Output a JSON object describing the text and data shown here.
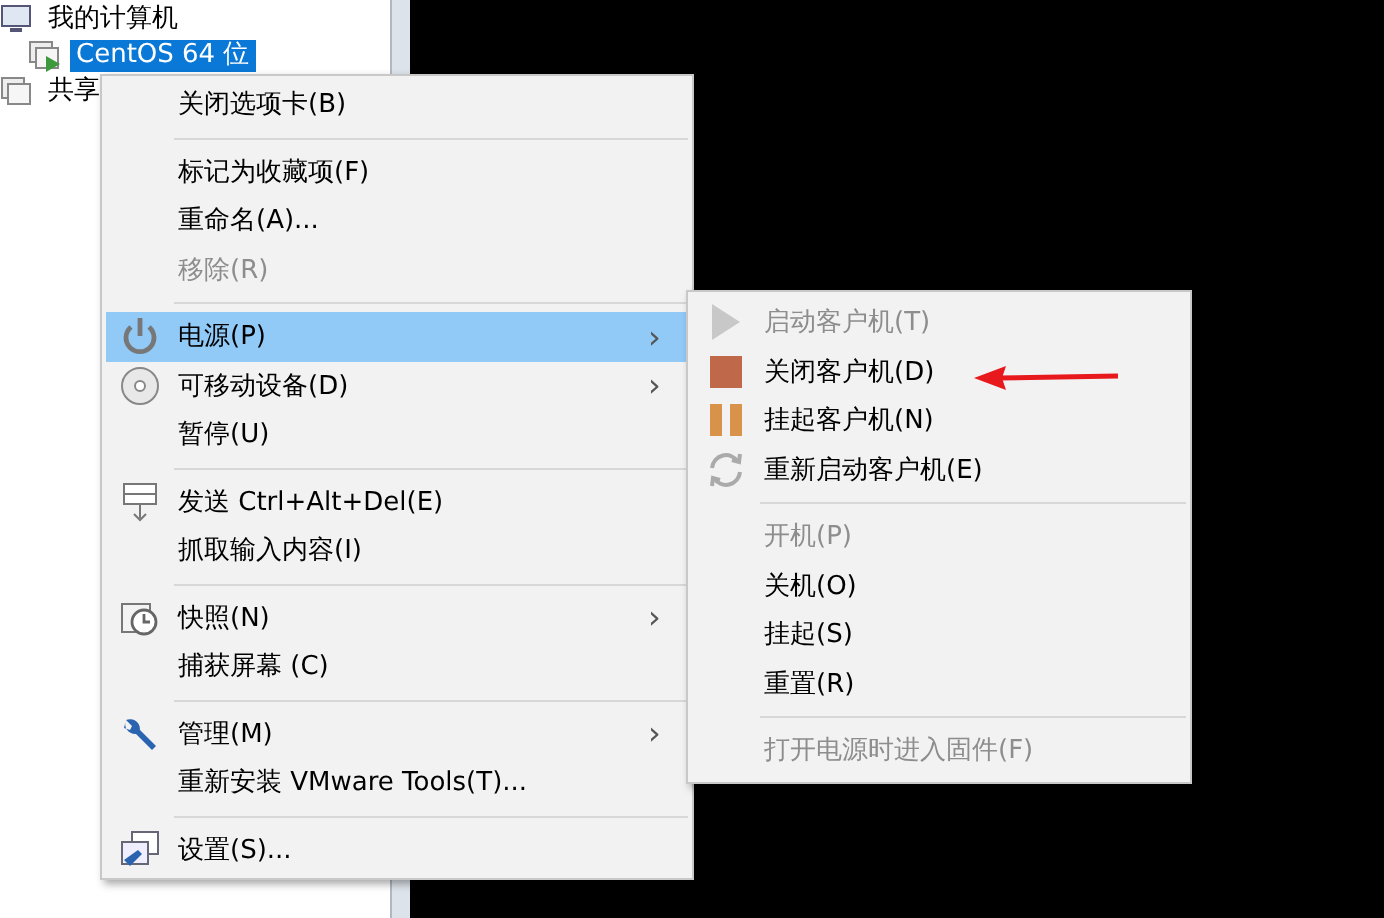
{
  "tree": [
    {
      "label": "我的计算机",
      "selected": false
    },
    {
      "label": "CentOS 64 位",
      "selected": true
    },
    {
      "label": "共享",
      "selected": false
    }
  ],
  "context_menu": [
    {
      "kind": "item",
      "label": "关闭选项卡(B)",
      "disabled": false,
      "selected": false
    },
    {
      "kind": "separator"
    },
    {
      "kind": "item",
      "label": "标记为收藏项(F)",
      "disabled": false,
      "selected": false
    },
    {
      "kind": "item",
      "label": "重命名(A)...",
      "disabled": false,
      "selected": false
    },
    {
      "kind": "item",
      "label": "移除(R)",
      "disabled": true,
      "selected": false
    },
    {
      "kind": "separator"
    },
    {
      "kind": "item",
      "label": "电源(P)",
      "submenu_arrow": "›",
      "disabled": false,
      "selected": true
    },
    {
      "kind": "item",
      "label": "可移动设备(D)",
      "submenu_arrow": "›",
      "disabled": false,
      "selected": false
    },
    {
      "kind": "item",
      "label": "暂停(U)",
      "disabled": false,
      "selected": false
    },
    {
      "kind": "separator"
    },
    {
      "kind": "item",
      "label": "发送 Ctrl+Alt+Del(E)",
      "disabled": false,
      "selected": false
    },
    {
      "kind": "item",
      "label": "抓取输入内容(I)",
      "disabled": false,
      "selected": false
    },
    {
      "kind": "separator"
    },
    {
      "kind": "item",
      "label": "快照(N)",
      "submenu_arrow": "›",
      "disabled": false,
      "selected": false
    },
    {
      "kind": "item",
      "label": "捕获屏幕 (C)",
      "disabled": false,
      "selected": false
    },
    {
      "kind": "separator"
    },
    {
      "kind": "item",
      "label": "管理(M)",
      "submenu_arrow": "›",
      "disabled": false,
      "selected": false
    },
    {
      "kind": "item",
      "label": "重新安装 VMware Tools(T)...",
      "disabled": false,
      "selected": false
    },
    {
      "kind": "separator"
    },
    {
      "kind": "item",
      "label": "设置(S)...",
      "disabled": false,
      "selected": false
    }
  ],
  "power_submenu": [
    {
      "kind": "item",
      "label": "启动客户机(T)",
      "disabled": true
    },
    {
      "kind": "item",
      "label": "关闭客户机(D)",
      "disabled": false
    },
    {
      "kind": "item",
      "label": "挂起客户机(N)",
      "disabled": false
    },
    {
      "kind": "item",
      "label": "重新启动客户机(E)",
      "disabled": false
    },
    {
      "kind": "separator"
    },
    {
      "kind": "item",
      "label": "开机(P)",
      "disabled": true
    },
    {
      "kind": "item",
      "label": "关机(O)",
      "disabled": false
    },
    {
      "kind": "item",
      "label": "挂起(S)",
      "disabled": false
    },
    {
      "kind": "item",
      "label": "重置(R)",
      "disabled": false
    },
    {
      "kind": "separator"
    },
    {
      "kind": "item",
      "label": "打开电源时进入固件(F)",
      "disabled": true
    }
  ]
}
